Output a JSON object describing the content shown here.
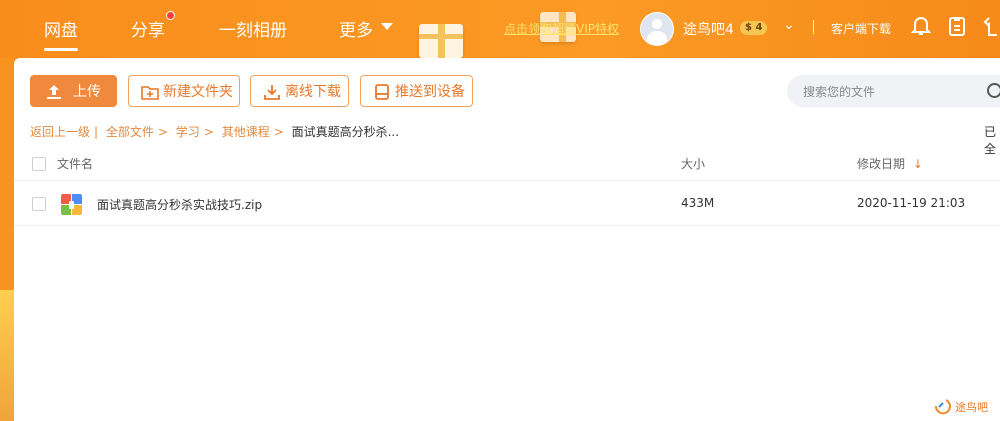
{
  "nav": {
    "items": [
      {
        "label": "网盘",
        "active": true
      },
      {
        "label": "分享",
        "dot": true
      },
      {
        "label": "一刻相册"
      },
      {
        "label": "更多"
      }
    ],
    "promo": "点击领取超级VIP特权"
  },
  "user": {
    "name": "途鸟吧4",
    "badge": "$ 4",
    "client_download": "客户端下载"
  },
  "toolbar": {
    "upload": "上传",
    "new_folder": "新建文件夹",
    "offline_download": "离线下载",
    "push_device": "推送到设备"
  },
  "search": {
    "placeholder": "搜索您的文件"
  },
  "breadcrumb": {
    "back": "返回上一级",
    "sep_bar": "|",
    "items": [
      "全部文件",
      "学习",
      "其他课程"
    ],
    "arrow": ">",
    "current": "面试真题高分秒杀..."
  },
  "right_cut_text": "已全",
  "table": {
    "headers": {
      "name": "文件名",
      "size": "大小",
      "modified": "修改日期",
      "sort_indicator": "↓"
    },
    "rows": [
      {
        "name": "面试真题高分秒杀实战技巧.zip",
        "size": "433M",
        "modified": "2020-11-19 21:03",
        "icon": "zip-file-icon"
      }
    ]
  },
  "watermark": "途鸟吧",
  "colors": {
    "brand_orange": "#f98d1c",
    "accent_text": "#e48a3f",
    "promo_yellow": "#ffe36b"
  }
}
